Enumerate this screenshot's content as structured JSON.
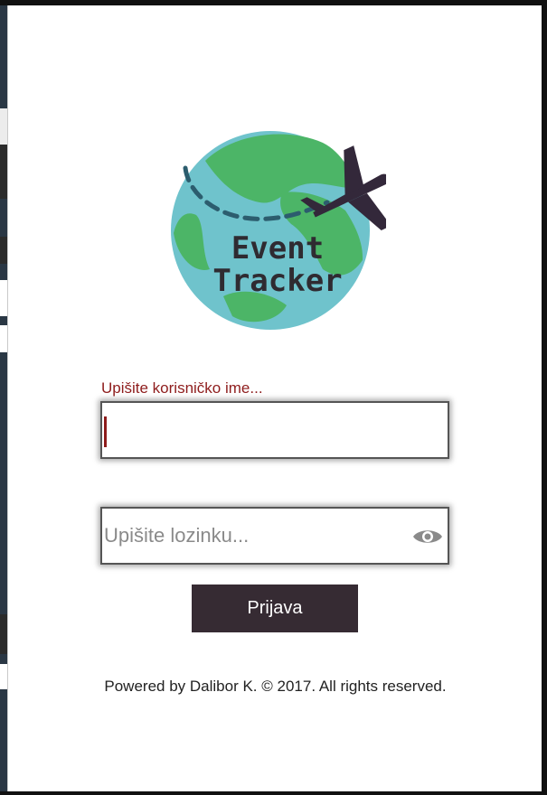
{
  "app": {
    "logo_line1": "Event",
    "logo_line2": "Tracker"
  },
  "login": {
    "username_label": "Upišite korisničko ime...",
    "username_value": "",
    "password_placeholder": "Upišite lozinku...",
    "password_value": "",
    "submit_label": "Prijava"
  },
  "footer": {
    "text": "Powered by Dalibor K. © 2017. All rights reserved."
  },
  "colors": {
    "accent": "#8e1c1c",
    "button_bg": "#362b33",
    "globe_ocean": "#6fc3cc",
    "globe_land": "#4cb567",
    "plane": "#33283a"
  },
  "icons": {
    "password_toggle": "eye-icon",
    "logo": "globe-plane-icon"
  }
}
